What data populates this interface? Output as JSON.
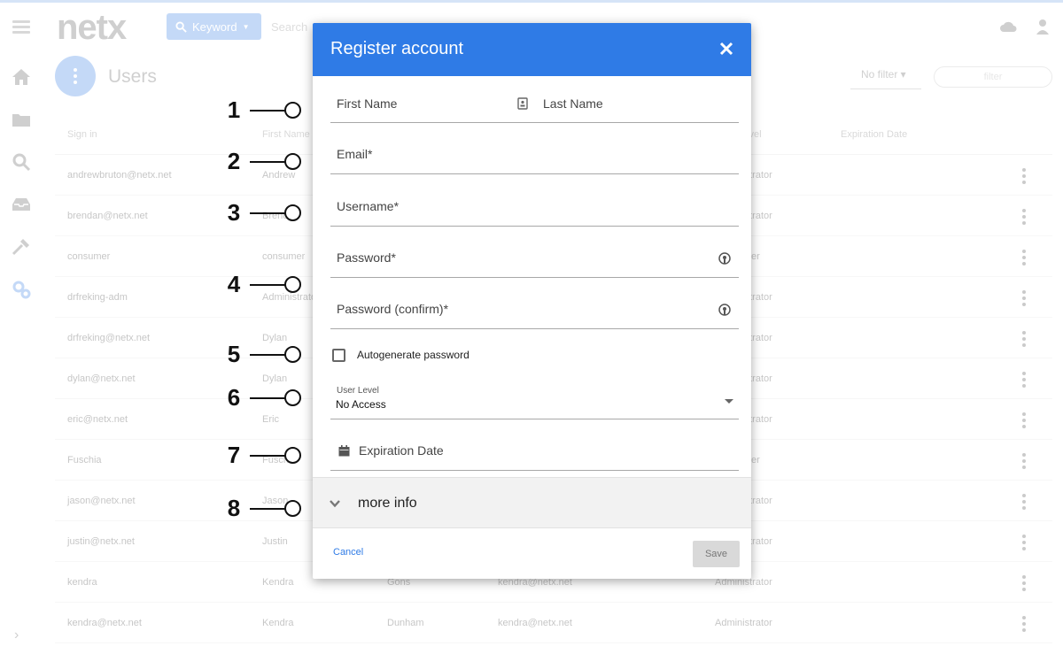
{
  "app": {
    "logo": "netx",
    "search_mode": "Keyword",
    "search_placeholder": "Search",
    "page_title": "Users",
    "filter_select": "No filter",
    "filter_placeholder": "filter"
  },
  "table": {
    "headers": [
      "Sign in",
      "First Name",
      "",
      "",
      "User Level",
      "Expiration Date"
    ],
    "rows": [
      [
        "andrewbruton@netx.net",
        "Andrew",
        "",
        "",
        "Administrator"
      ],
      [
        "brendan@netx.net",
        "Brendan",
        "",
        "",
        "Administrator"
      ],
      [
        "consumer",
        "consumer",
        "",
        "",
        "Consumer"
      ],
      [
        "drfreking-adm",
        "Administrator",
        "",
        "",
        "Administrator"
      ],
      [
        "drfreking@netx.net",
        "Dylan",
        "",
        "",
        "Administrator"
      ],
      [
        "dylan@netx.net",
        "Dylan",
        "",
        "",
        "Administrator"
      ],
      [
        "eric@netx.net",
        "Eric",
        "",
        "",
        "Administrator"
      ],
      [
        "Fuschia",
        "Fuschia",
        "",
        "",
        "Consumer"
      ],
      [
        "jason@netx.net",
        "Jason",
        "",
        "",
        "Administrator"
      ],
      [
        "justin@netx.net",
        "Justin",
        "",
        "",
        "Administrator"
      ],
      [
        "kendra",
        "Kendra",
        "Gons",
        "kendra@netx.net",
        "Administrator"
      ],
      [
        "kendra@netx.net",
        "Kendra",
        "Dunham",
        "kendra@netx.net",
        "Administrator"
      ]
    ]
  },
  "callouts": [
    "1",
    "2",
    "3",
    "4",
    "5",
    "6",
    "7",
    "8"
  ],
  "modal": {
    "title": "Register account",
    "first_name": "First Name",
    "last_name": "Last Name",
    "email": "Email*",
    "username": "Username*",
    "password": "Password*",
    "password_confirm": "Password (confirm)*",
    "autogenerate": "Autogenerate password",
    "user_level_label": "User Level",
    "user_level_value": "No Access",
    "expiration": "Expiration Date",
    "more_info": "more info",
    "cancel": "Cancel",
    "save": "Save"
  },
  "colors": {
    "primary": "#2f7be6",
    "header_text": "#ffffff",
    "save_disabled": "#d9d9d9"
  }
}
